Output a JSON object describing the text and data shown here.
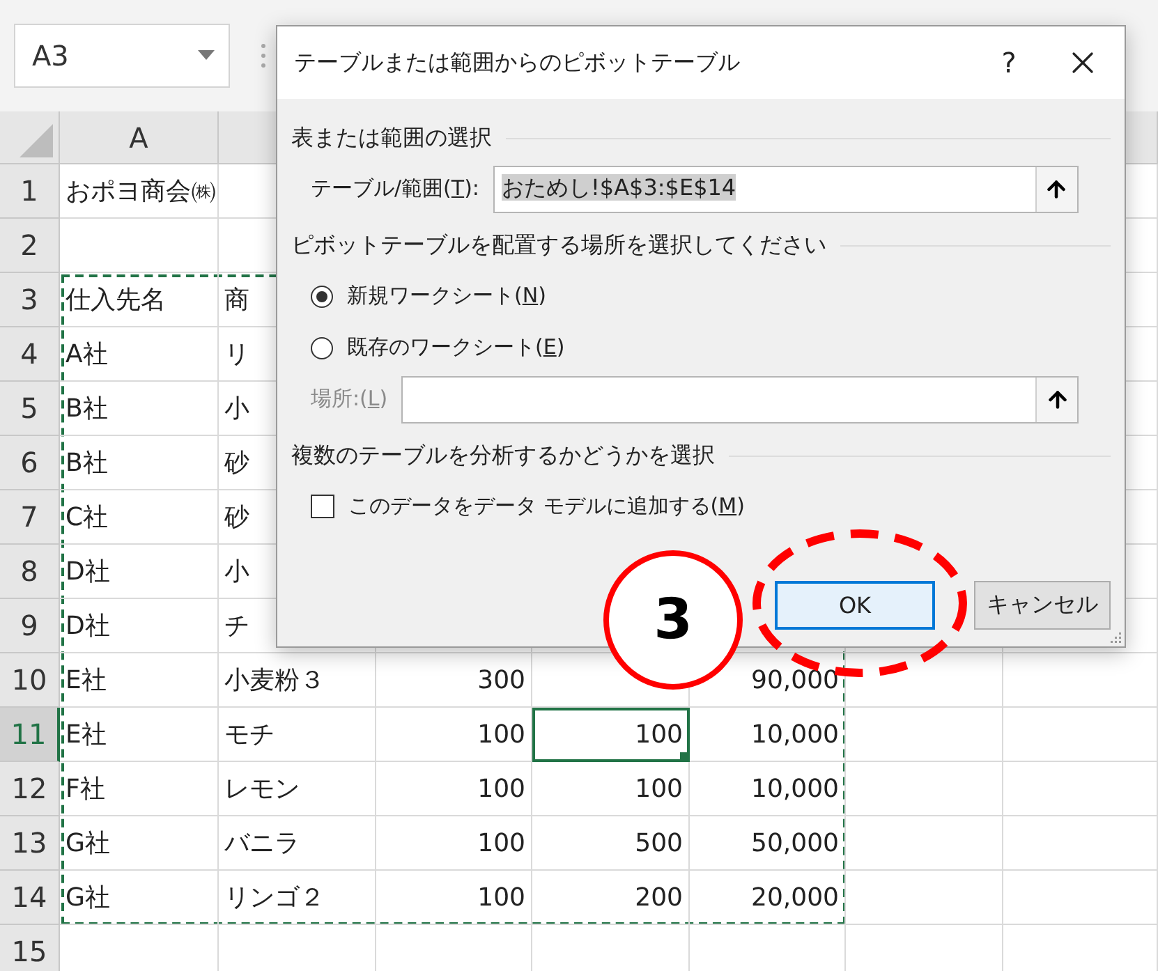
{
  "name_box": {
    "value": "A3"
  },
  "sheet": {
    "column_headers": [
      "A"
    ],
    "rows": [
      {
        "header": "1",
        "selected": false,
        "cells": [
          {
            "value": "おポヨ商会㈱",
            "selected": false
          }
        ]
      },
      {
        "header": "2",
        "selected": false
      },
      {
        "header": "3",
        "selected": false,
        "cells": [
          {
            "value": "仕入先名",
            "selected": false
          },
          {
            "value": "商",
            "selected": false
          }
        ]
      },
      {
        "header": "4",
        "selected": false,
        "cells": [
          {
            "value": "A社",
            "selected": false
          },
          {
            "value": "リ",
            "selected": false
          }
        ]
      },
      {
        "header": "5",
        "selected": false,
        "cells": [
          {
            "value": "B社",
            "selected": false
          },
          {
            "value": "小",
            "selected": false
          }
        ]
      },
      {
        "header": "6",
        "selected": false,
        "cells": [
          {
            "value": "B社",
            "selected": false
          },
          {
            "value": "砂",
            "selected": false
          }
        ]
      },
      {
        "header": "7",
        "selected": false,
        "cells": [
          {
            "value": "C社",
            "selected": false
          },
          {
            "value": "砂",
            "selected": false
          }
        ]
      },
      {
        "header": "8",
        "selected": false,
        "cells": [
          {
            "value": "D社",
            "selected": false
          },
          {
            "value": "小",
            "selected": false
          }
        ]
      },
      {
        "header": "9",
        "selected": false,
        "cells": [
          {
            "value": "D社",
            "selected": false
          },
          {
            "value": "チ",
            "selected": false
          }
        ]
      },
      {
        "header": "10",
        "selected": false,
        "cells": [
          {
            "value": "E社",
            "selected": false
          },
          {
            "value": "小麦粉３",
            "selected": false
          },
          {
            "value": "300",
            "selected": false
          },
          {
            "selected": false
          },
          {
            "value": "90,000",
            "selected": false
          }
        ]
      },
      {
        "header": "11",
        "selected": true,
        "cells": [
          {
            "value": "E社",
            "selected": false
          },
          {
            "value": "モチ",
            "selected": false
          },
          {
            "value": "100",
            "selected": false
          },
          {
            "value": "100",
            "selected": true
          },
          {
            "value": "10,000",
            "selected": false
          }
        ]
      },
      {
        "header": "12",
        "selected": false,
        "cells": [
          {
            "value": "F社",
            "selected": false
          },
          {
            "value": "レモン",
            "selected": false
          },
          {
            "value": "100",
            "selected": false
          },
          {
            "value": "100",
            "selected": false
          },
          {
            "value": "10,000",
            "selected": false
          }
        ]
      },
      {
        "header": "13",
        "selected": false,
        "cells": [
          {
            "value": "G社",
            "selected": false
          },
          {
            "value": "バニラ",
            "selected": false
          },
          {
            "value": "100",
            "selected": false
          },
          {
            "value": "500",
            "selected": false
          },
          {
            "value": "50,000",
            "selected": false
          }
        ]
      },
      {
        "header": "14",
        "selected": false,
        "cells": [
          {
            "value": "G社",
            "selected": false
          },
          {
            "value": "リンゴ２",
            "selected": false
          },
          {
            "value": "100",
            "selected": false
          },
          {
            "value": "200",
            "selected": false
          },
          {
            "value": "20,000",
            "selected": false
          }
        ]
      },
      {
        "header": "15",
        "selected": false
      }
    ]
  },
  "dialog": {
    "title": "テーブルまたは範囲からのピボットテーブル",
    "help": "?",
    "sections": [
      {
        "heading": "表または範囲の選択",
        "items": [
          {
            "kind": "field",
            "label_before": "テーブル/範囲(",
            "accesskey": "T",
            "label_after": "):",
            "value": "おためし!$A$3:$E$14",
            "value_selected": true,
            "disabled": false
          }
        ]
      },
      {
        "heading": "ピボットテーブルを配置する場所を選択してください",
        "items": [
          {
            "kind": "radio",
            "label_before": "新規ワークシート(",
            "accesskey": "N",
            "label_after": ")",
            "selected": true
          },
          {
            "kind": "radio",
            "label_before": "既存のワークシート(",
            "accesskey": "E",
            "label_after": ")",
            "selected": false
          },
          {
            "kind": "field",
            "label_before": "場所:(",
            "accesskey": "L",
            "label_after": ")",
            "disabled": true
          }
        ]
      },
      {
        "heading": "複数のテーブルを分析するかどうかを選択",
        "items": [
          {
            "kind": "checkbox",
            "label_before": "このデータをデータ モデルに追加する(",
            "accesskey": "M",
            "label_after": ")",
            "checked": false
          }
        ]
      }
    ],
    "buttons": [
      {
        "label": "OK",
        "default": true
      },
      {
        "label": "キャンセル",
        "default": false
      }
    ]
  },
  "annotation": {
    "step": "3"
  }
}
